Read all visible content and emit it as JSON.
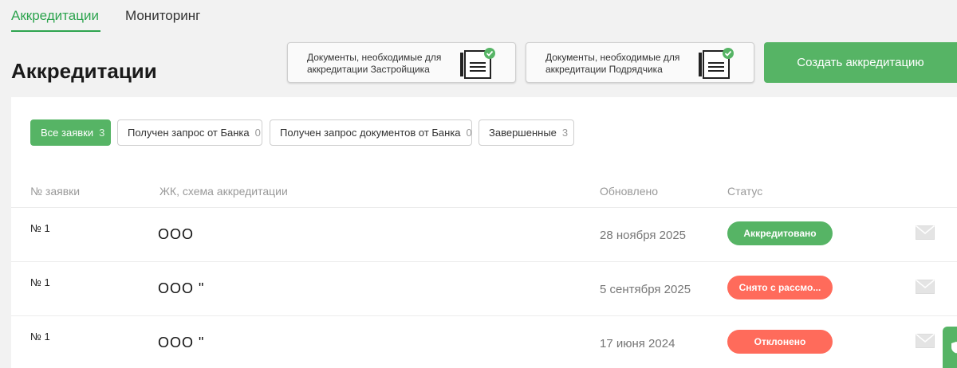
{
  "tabs": [
    {
      "label": "Аккредитации",
      "active": true
    },
    {
      "label": "Мониторинг",
      "active": false
    }
  ],
  "page_title": "Аккредитации",
  "doc_cards": [
    {
      "text": "Документы, необходимые для аккредитации Застройщика",
      "icon": "document-check-icon"
    },
    {
      "text": "Документы, необходимые для аккредитации Подрядчика",
      "icon": "document-check-icon"
    }
  ],
  "create_button": "Создать аккредитацию",
  "filters": [
    {
      "label": "Все заявки",
      "count": "3",
      "active": true
    },
    {
      "label": "Получен запрос от Банка",
      "count": "0",
      "active": false
    },
    {
      "label": "Получен запрос документов от Банка",
      "count": "0",
      "active": false
    },
    {
      "label": "Завершенные",
      "count": "3",
      "active": false
    }
  ],
  "table": {
    "headers": [
      "№ заявки",
      "ЖК, схема аккредитации",
      "Обновлено",
      "Статус"
    ],
    "rows": [
      {
        "number": "№ 1",
        "name": "ООО",
        "date": "28 ноября 2025",
        "status": "Аккредитовано",
        "status_color": "#56b465"
      },
      {
        "number": "№ 1",
        "name": "ООО \"",
        "date": "5 сентября 2025",
        "status": "Снято с рассмо...",
        "status_color": "#ff6b5b"
      },
      {
        "number": "№ 1",
        "name": "ООО \"",
        "date": "17 июня 2024",
        "status": "Отклонено",
        "status_color": "#ff6b5b"
      }
    ]
  },
  "colors": {
    "accent": "#56b465",
    "tab_active": "#2ea44f",
    "status_negative": "#ff6b5b"
  }
}
